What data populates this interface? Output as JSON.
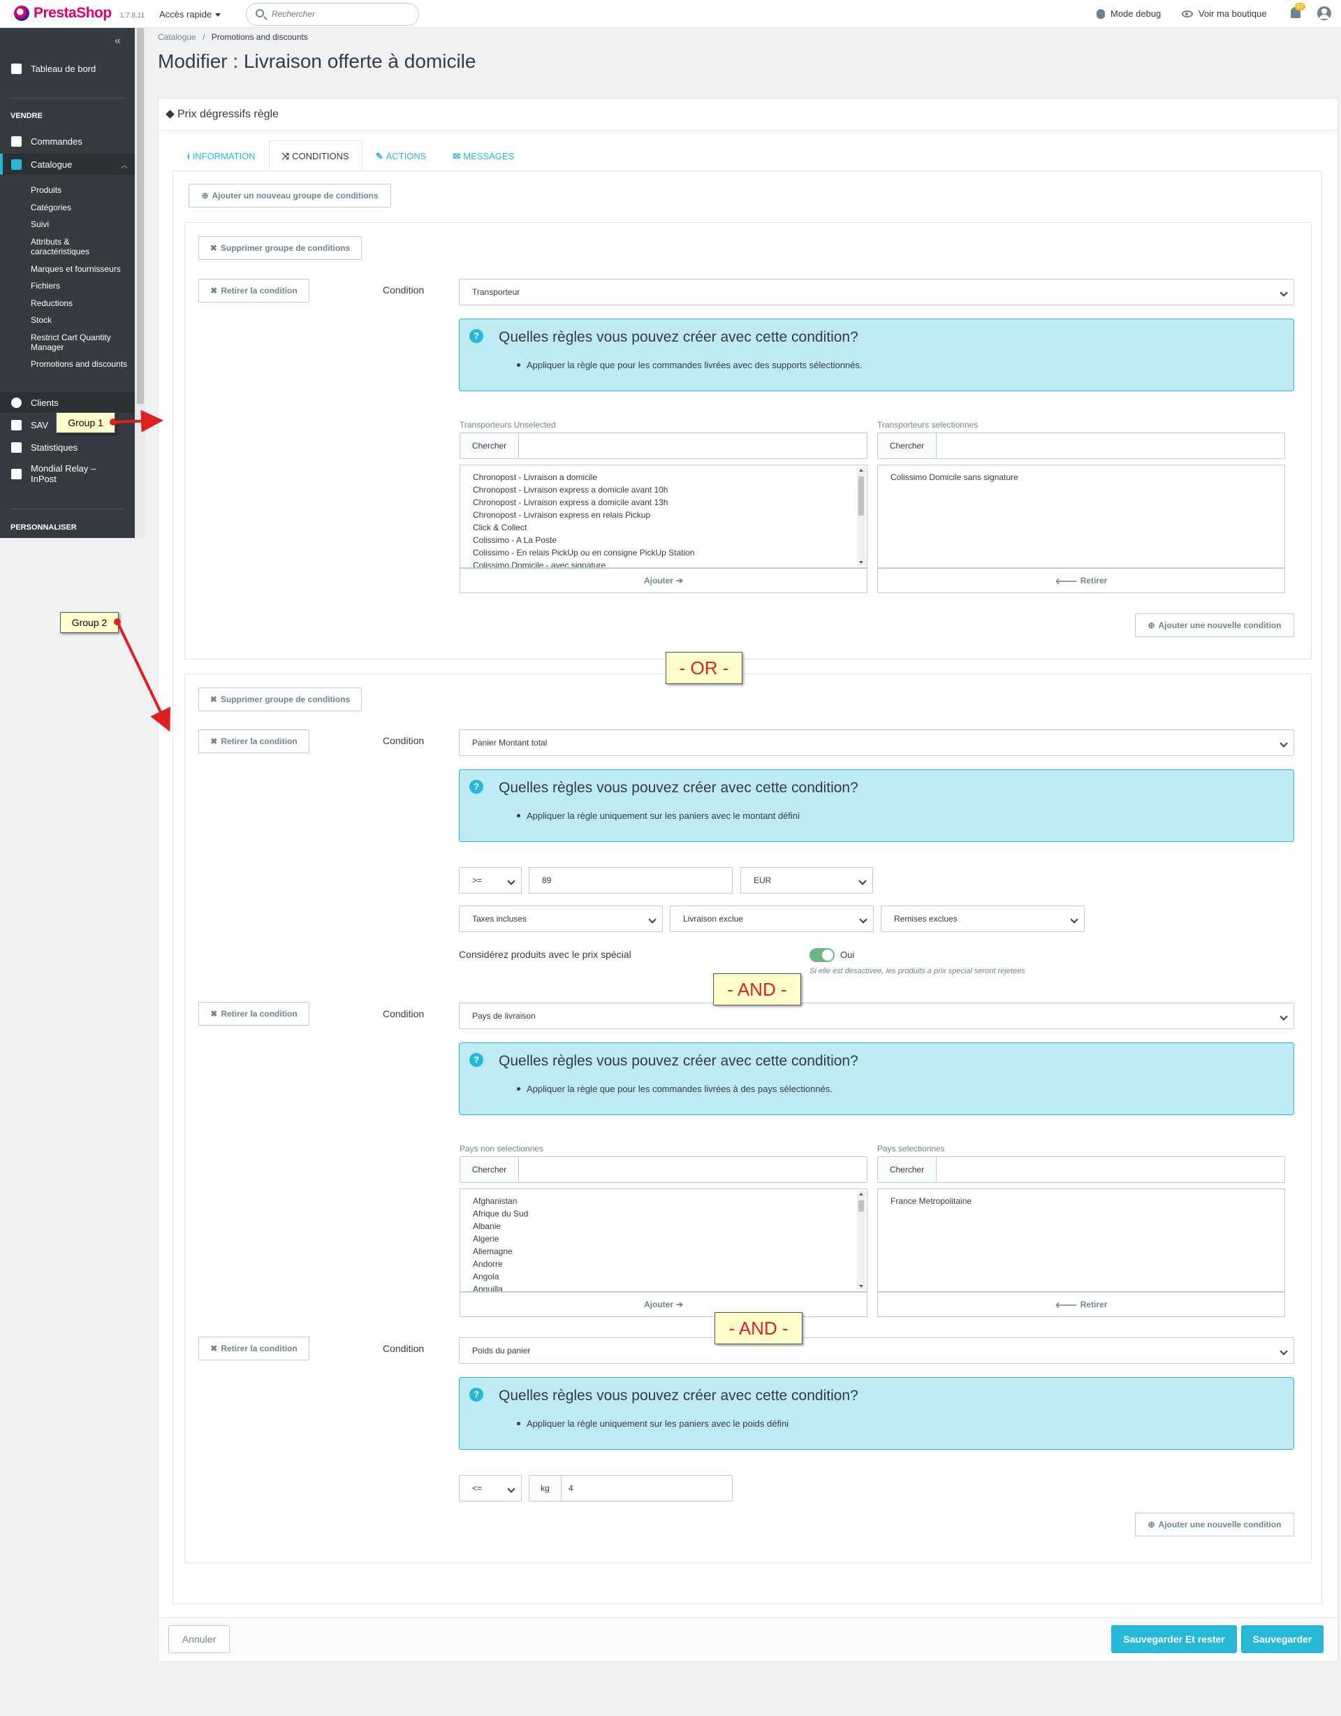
{
  "header": {
    "logo_text": "PrestaShop",
    "version": "1.7.8.11",
    "quick_access": "Accès rapide",
    "search_placeholder": "Rechercher",
    "debug_mode": "Mode debug",
    "view_shop": "Voir ma boutique",
    "notif_count": "67"
  },
  "sidebar": {
    "collapse": "«",
    "dashboard": "Tableau de bord",
    "section_sell": "VENDRE",
    "orders": "Commandes",
    "catalog": "Catalogue",
    "catalog_sub": [
      "Produits",
      "Catégories",
      "Suivi",
      "Attributs & caractéristiques",
      "Marques et fournisseurs",
      "Fichiers",
      "Reductions",
      "Stock",
      "Restrict Cart Quantity Manager",
      "Promotions and discounts"
    ],
    "clients": "Clients",
    "sav": "SAV",
    "stats": "Statistiques",
    "mondial": "Mondial Relay – InPost",
    "section_custom": "PERSONNALISER"
  },
  "breadcrumb": {
    "parent": "Catalogue",
    "current": "Promotions and discounts"
  },
  "page_title": "Modifier : Livraison offerte à domicile",
  "panel": {
    "heading": "Prix dégressifs règle",
    "tabs": [
      {
        "icon": "i",
        "label": "INFORMATION"
      },
      {
        "icon": "⤨",
        "label": "CONDITIONS"
      },
      {
        "icon": "✎",
        "label": "ACTIONS"
      },
      {
        "icon": "✉",
        "label": "MESSAGES"
      }
    ],
    "add_group": "Ajouter un nouveau groupe de conditions",
    "remove_group": "Supprimer groupe de conditions",
    "remove_condition": "Retirer la condition",
    "condition_label": "Condition",
    "add_condition": "Ajouter une nouvelle condition",
    "info_title": "Quelles règles vous pouvez créer avec cette condition?",
    "search_addon": "Chercher",
    "add_btn": "Ajouter",
    "remove_btn": "Retirer"
  },
  "group1": {
    "condition_type": "Transporteur",
    "info_text": "Appliquer la règle que pour les commandes livrées avec des supports sélectionnés.",
    "left_label": "Transporteurs Unselected",
    "right_label": "Transporteurs selectionnes",
    "left_items": [
      "Chronopost - Livraison a domicile",
      "Chronopost - Livraison express a domicile avant 10h",
      "Chronopost - Livraison express a domicile avant 13h",
      "Chronopost - Livraison express en relais Pickup",
      "Click & Collect",
      "Colissimo - A La Poste",
      "Colissimo - En relais PickUp ou en consigne PickUp Station",
      "Colissimo Domicile - avec signature"
    ],
    "right_items": [
      "Colissimo Domicile sans signature"
    ]
  },
  "or_label": "- OR -",
  "and_label": "- AND -",
  "group2": {
    "cond1": {
      "condition_type": "Panier Montant total",
      "info_text": "Appliquer la règle uniquement sur les paniers avec le montant défini",
      "operator": ">=",
      "amount": "89",
      "currency": "EUR",
      "tax": "Taxes incluses",
      "shipping": "Livraison exclue",
      "discounts": "Remises exclues",
      "special_label": "Considérez produits avec le prix spécial",
      "special_value": "Oui",
      "special_hint": "Si elle est desactivee, les produits a prix special seront rejetees"
    },
    "cond2": {
      "condition_type": "Pays de livraison",
      "info_text": "Appliquer la règle que pour les commandes livrées à des pays sélectionnés.",
      "left_label": "Pays non selectionnes",
      "right_label": "Pays selectionnes",
      "left_items": [
        "Afghanistan",
        "Afrique du Sud",
        "Albanie",
        "Algerie",
        "Allemagne",
        "Andorre",
        "Angola",
        "Anguilla"
      ],
      "right_items": [
        "France Metropolitaine"
      ]
    },
    "cond3": {
      "condition_type": "Poids du panier",
      "info_text": "Appliquer la règle uniquement sur les paniers avec le poids défini",
      "operator": "<=",
      "unit": "kg",
      "weight": "4"
    }
  },
  "callouts": {
    "group1": "Group 1",
    "group2": "Group 2"
  },
  "footer": {
    "cancel": "Annuler",
    "save_stay": "Sauvegarder Et rester",
    "save": "Sauvegarder"
  },
  "colors": {
    "accent": "#25b9d7",
    "brand": "#df0067",
    "sidebar": "#363a41",
    "annotation": "#e02020"
  }
}
